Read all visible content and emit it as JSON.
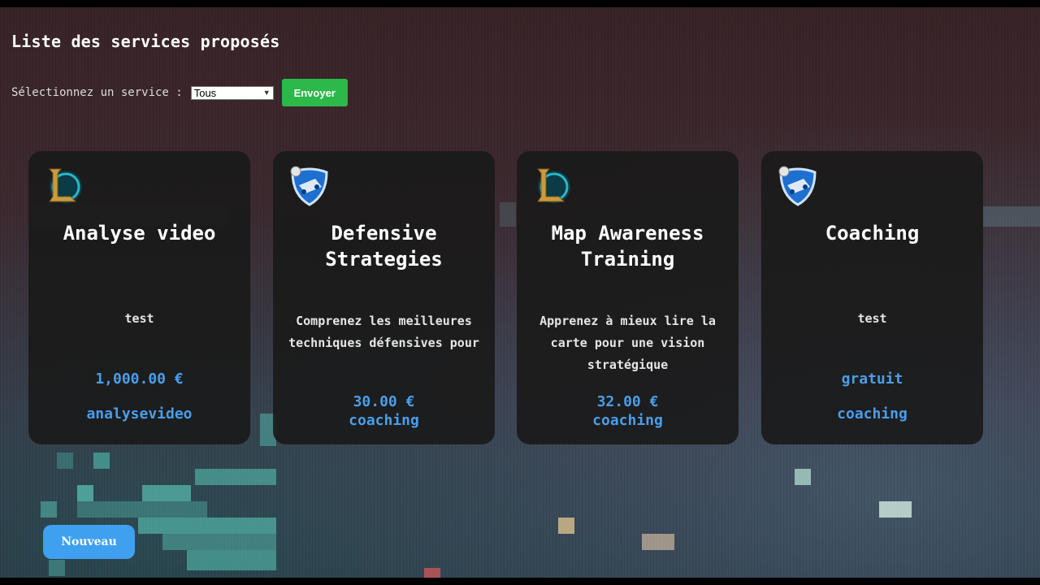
{
  "header": {
    "title": "Liste des services proposés"
  },
  "filter": {
    "label": "Sélectionnez un service :",
    "selected": "Tous",
    "submit_label": "Envoyer"
  },
  "cards": [
    {
      "game_icon": "league-of-legends-icon",
      "name": "Analyse video",
      "description": "test",
      "price": "1,000.00 €",
      "category": "analysevideo"
    },
    {
      "game_icon": "rocket-league-icon",
      "name": "Defensive Strategies",
      "description": "Comprenez les meilleures techniques défensives pour",
      "price": "30.00 €",
      "category": "coaching"
    },
    {
      "game_icon": "league-of-legends-icon",
      "name": "Map Awareness Training",
      "description": "Apprenez à mieux lire la carte pour une vision stratégique",
      "price": "32.00 €",
      "category": "coaching"
    },
    {
      "game_icon": "rocket-league-icon",
      "name": "Coaching",
      "description": "test",
      "price": "gratuit",
      "category": "coaching"
    }
  ],
  "actions": {
    "new_label": "Nouveau"
  },
  "colors": {
    "accent_blue": "#4a9eea",
    "send_green": "#2db84a",
    "new_blue": "#3fa0f0",
    "card_bg": "#1a1a1a"
  }
}
